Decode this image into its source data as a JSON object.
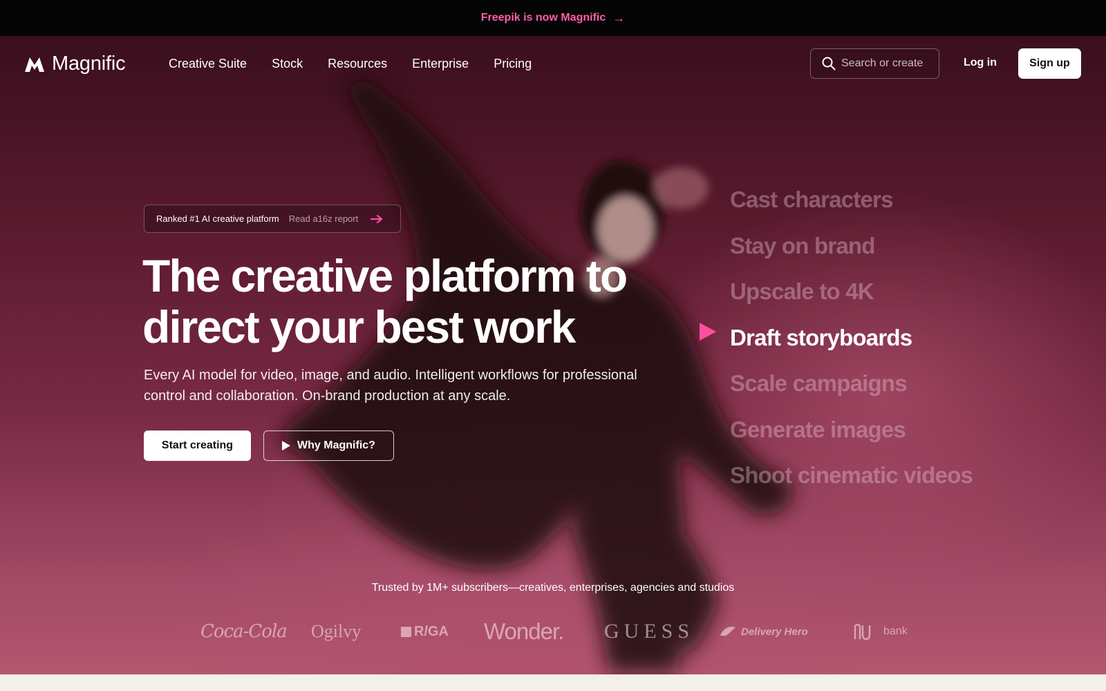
{
  "announcement": {
    "text": "Freepik is now Magnific",
    "arrow": "→"
  },
  "header": {
    "logo_text": "Magnific",
    "nav": [
      "Creative Suite",
      "Stock",
      "Resources",
      "Enterprise",
      "Pricing"
    ],
    "search_placeholder": "Search or create",
    "login_label": "Log in",
    "signup_label": "Sign up"
  },
  "hero": {
    "badge": {
      "label": "Ranked #1 AI creative platform",
      "link": "Read a16z report"
    },
    "headline": "The creative platform to direct your best work",
    "subheadline": "Every AI model for video, image, and audio. Intelligent workflows for professional control and collaboration. On-brand production at any scale.",
    "cta_primary": "Start creating",
    "cta_secondary": "Why Magnific?"
  },
  "features": {
    "items": [
      "Cast characters",
      "Stay on brand",
      "Upscale to 4K",
      "Draft storyboards",
      "Scale campaigns",
      "Generate images",
      "Shoot cinematic videos"
    ],
    "active_index": 3
  },
  "trusted": {
    "text": "Trusted by 1M+ subscribers—creatives, enterprises, agencies and studios",
    "logos": {
      "coca_cola": "Coca-Cola",
      "ogilvy": "Ogilvy",
      "rga": "R/GA",
      "wonder": "Wonder.",
      "guess": "GUESS",
      "delivery_hero": "Delivery Hero",
      "nubank": "bank"
    }
  },
  "colors": {
    "accent": "#ff4fa0",
    "announcement_text": "#ff5fa6",
    "hero_top": "#3a0f1d",
    "hero_bottom": "#b4566f"
  }
}
